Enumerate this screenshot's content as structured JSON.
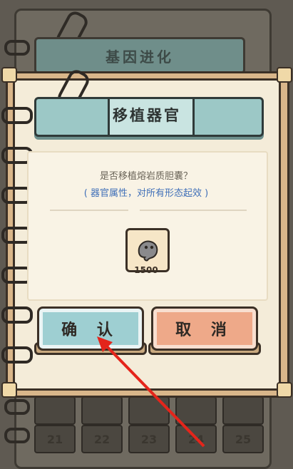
{
  "background": {
    "panel_title": "基因进化",
    "grid_numbers": [
      "21",
      "22",
      "23",
      "24",
      "25"
    ]
  },
  "dialog": {
    "title": "移植器官",
    "question": "是否移植熔岩质胆囊？",
    "hint": "( 器官属性，对所有形态起效 )",
    "item": {
      "icon": "gray-blob-creature-icon",
      "count": "1500"
    },
    "confirm_label": "确 认",
    "cancel_label": "取 消"
  },
  "colors": {
    "title_banner": "#9cc8c6",
    "confirm": "#9ecfd2",
    "cancel": "#eea989",
    "hint_text": "#3f6fb8",
    "arrow": "#e4251b"
  }
}
